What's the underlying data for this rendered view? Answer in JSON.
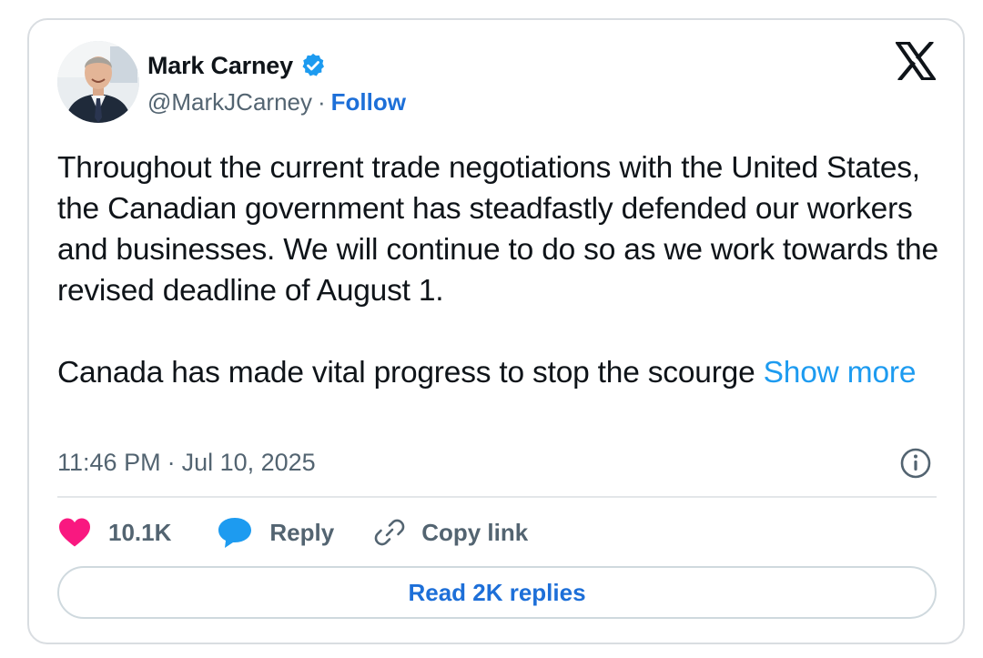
{
  "author": {
    "display_name": "Mark Carney",
    "verified": true,
    "handle": "@MarkJCarney",
    "separator": "·",
    "follow_label": "Follow"
  },
  "tweet": {
    "paragraph_1": "Throughout the current trade negotiations with the United States, the Canadian government has steadfastly defended our workers and businesses. We will continue to do so as we work towards the revised deadline of August 1.",
    "paragraph_2": "Canada has made vital progress to stop the scourge ",
    "show_more_label": "Show more"
  },
  "meta": {
    "time": "11:46 PM",
    "separator": "·",
    "date": "Jul 10, 2025"
  },
  "actions": {
    "like_count": "10.1K",
    "reply_label": "Reply",
    "copy_link_label": "Copy link"
  },
  "footer": {
    "read_replies_label": "Read 2K replies"
  },
  "colors": {
    "link_blue": "#1d6fd8",
    "show_more_blue": "#1d9bf0",
    "verified_blue": "#1d9bf0",
    "like_pink": "#f91880",
    "reply_blue": "#1d9bf0",
    "secondary_text": "#536471",
    "primary_text": "#0f1419"
  },
  "icons": {
    "verified": "verified-badge-icon",
    "brand": "x-logo-icon",
    "info": "info-icon",
    "like": "heart-icon",
    "reply": "speech-bubble-icon",
    "copy_link": "link-icon"
  }
}
